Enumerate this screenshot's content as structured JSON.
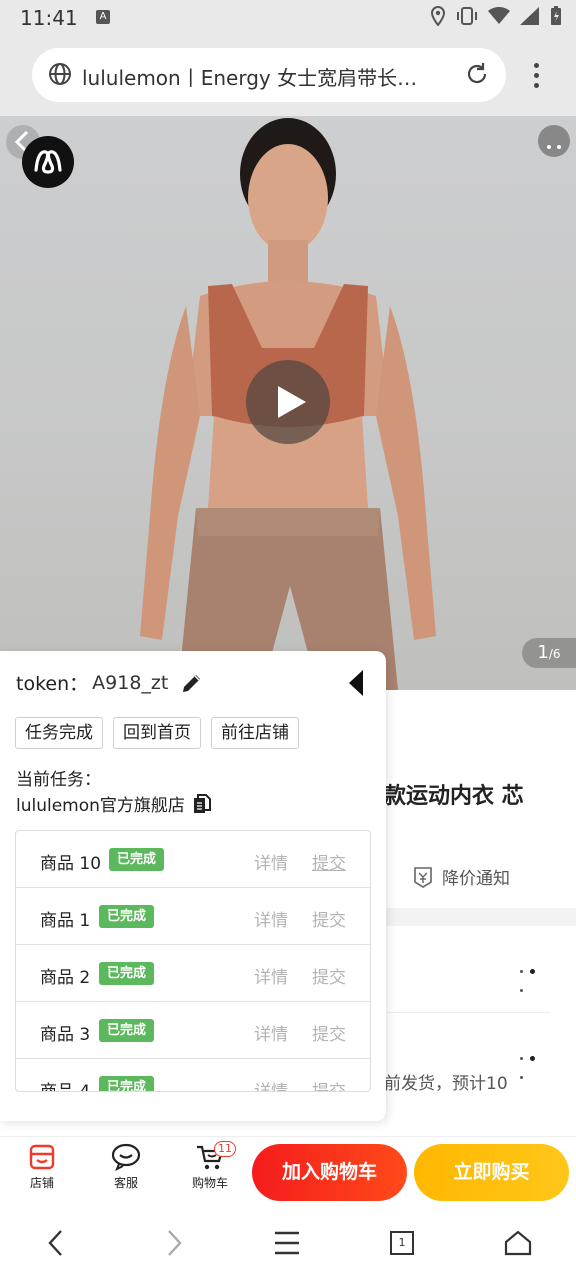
{
  "status_bar": {
    "time": "11:41",
    "keyboard_badge": "A"
  },
  "browser": {
    "url_title": "lululemon丨Energy 女士宽肩带长…"
  },
  "hero": {
    "page_current": "1",
    "page_total": "/6"
  },
  "product": {
    "title_fragment": "款运动内衣 芯",
    "price_alert": "降价通知",
    "shipping_fragment": "前发货，预计10"
  },
  "task_panel": {
    "token_label": "token：",
    "token_value": "A918_zt",
    "buttons": [
      "任务完成",
      "回到首页",
      "前往店铺"
    ],
    "current_task_label": "当前任务：",
    "current_task_shop": "lululemon官方旗舰店",
    "status_label": "已完成",
    "detail_label": "详情",
    "submit_label": "提交",
    "tasks": [
      {
        "name": "商品 10"
      },
      {
        "name": "商品 1"
      },
      {
        "name": "商品 2"
      },
      {
        "name": "商品 3"
      },
      {
        "name": "商品 4"
      }
    ]
  },
  "action_bar": {
    "shop": "店铺",
    "service": "客服",
    "cart": "购物车",
    "cart_count": "11",
    "add_to_cart": "加入购物车",
    "buy_now": "立即购买"
  },
  "nav_bar": {
    "tab_count": "1"
  },
  "colors": {
    "accent_red": "#f51c1c",
    "accent_yellow": "#ffb800",
    "done_green": "#5cb85c"
  }
}
